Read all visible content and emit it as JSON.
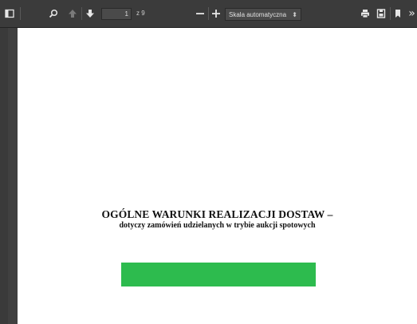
{
  "toolbar": {
    "page_value": "1",
    "page_count_text": "z 9",
    "zoom_label": "Skala automatyczna",
    "zoom_caret": "⬍",
    "more_label": "»",
    "icons": [
      "sidebar-toggle-icon",
      "search-icon",
      "previous-page-icon",
      "next-page-icon",
      "zoom-out-icon",
      "zoom-in-icon",
      "print-icon",
      "download-icon",
      "bookmark-icon",
      "more-tools-icon"
    ]
  },
  "document": {
    "title": "OGÓLNE WARUNKI REALIZACJI DOSTAW –",
    "subtitle": "dotyczy zamówień udzielanych w trybie aukcji spotowych"
  },
  "colors": {
    "toolbar_bg": "#3b3b3b",
    "viewer_bg": "#404040",
    "green_bar": "#2dbb4e"
  }
}
